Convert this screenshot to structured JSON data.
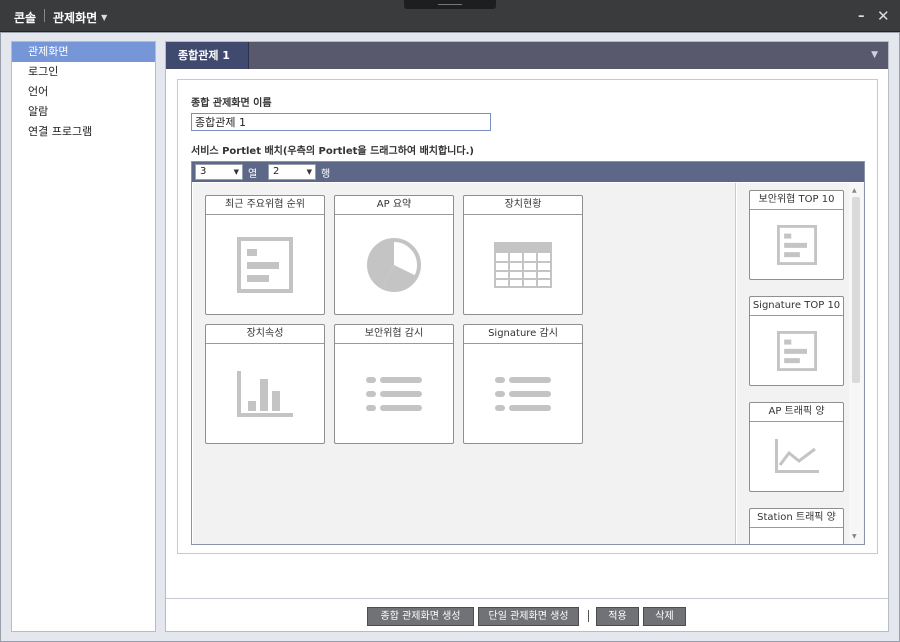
{
  "titlebar": {
    "app_name": "콘솔",
    "view_name": "관제화면"
  },
  "sidebar": {
    "items": [
      {
        "label": "관제화면",
        "active": true
      },
      {
        "label": "로그인",
        "active": false
      },
      {
        "label": "언어",
        "active": false
      },
      {
        "label": "알람",
        "active": false
      },
      {
        "label": "연결 프로그램",
        "active": false
      }
    ]
  },
  "main": {
    "tab_label": "종합관제 1",
    "name_label": "종합 관제화면 이름",
    "name_value": "종합관제 1",
    "layout_label": "서비스 Portlet 배치(우측의 Portlet을 드래그하여 배치합니다.)",
    "columns": {
      "value": "3",
      "label": "열"
    },
    "rows": {
      "value": "2",
      "label": "행"
    },
    "grid_portlets": [
      {
        "title": "최근 주요위협 순위",
        "icon": "list-doc-icon"
      },
      {
        "title": "AP 요약",
        "icon": "pie-chart-icon"
      },
      {
        "title": "장치현황",
        "icon": "table-icon"
      },
      {
        "title": "장치속성",
        "icon": "bar-chart-icon"
      },
      {
        "title": "보안위협 감시",
        "icon": "bullet-list-icon"
      },
      {
        "title": "Signature 감시",
        "icon": "bullet-list-icon"
      }
    ],
    "available_portlets": [
      {
        "title": "보안위협 TOP 10",
        "icon": "list-doc-icon"
      },
      {
        "title": "Signature TOP 10",
        "icon": "list-doc-icon"
      },
      {
        "title": "AP 트래픽 양",
        "icon": "line-chart-icon"
      },
      {
        "title": "Station 트래픽 양",
        "icon": ""
      }
    ]
  },
  "buttons": {
    "create_combined": "종합 관제화면 생성",
    "create_single": "단일 관제화면 생성",
    "apply": "적용",
    "delete": "삭제"
  }
}
